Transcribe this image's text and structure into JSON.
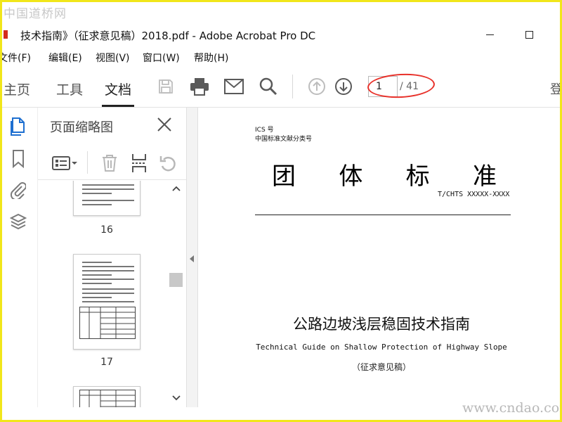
{
  "watermark": {
    "site_text": "中国道桥网",
    "url_text": "www.cndao.com"
  },
  "window": {
    "title": "技术指南》（征求意见稿）2018.pdf - Adobe Acrobat Pro DC",
    "controls": [
      "minimize-icon",
      "maximize-icon"
    ]
  },
  "menu": {
    "items": [
      "文件(F)",
      "编辑(E)",
      "视图(V)",
      "窗口(W)",
      "帮助(H)"
    ]
  },
  "nav": {
    "tabs": [
      {
        "label": "主页",
        "active": false
      },
      {
        "label": "工具",
        "active": false
      },
      {
        "label": "文档",
        "active": true
      }
    ],
    "tools": [
      "save-icon",
      "print-icon",
      "email-icon",
      "search-icon",
      "arrow-up-icon",
      "arrow-down-icon"
    ],
    "page_current": "1",
    "page_total": "/ 41",
    "right_label": "登"
  },
  "rail": {
    "icons": [
      "page-thumbnails-icon",
      "bookmark-icon",
      "attachment-icon",
      "layers-icon"
    ]
  },
  "thumbnails_panel": {
    "title": "页面缩略图",
    "tools": [
      "options-icon",
      "delete-icon",
      "insert-page-icon",
      "rotate-icon"
    ],
    "pages": [
      {
        "label": "16"
      },
      {
        "label": "17"
      }
    ]
  },
  "document": {
    "ics_label": "ICS 号",
    "classification_label": "中国标准文献分类号",
    "standard_type": [
      "团",
      "体",
      "标",
      "准"
    ],
    "standard_code": "T/CHTS XXXXX-XXXX",
    "main_title": "公路边坡浅层稳固技术指南",
    "english_title": "Technical Guide on Shallow Protection of Highway Slope",
    "draft_note": "（征求意见稿）"
  },
  "colors": {
    "highlight": "#e8312a",
    "frame": "#f1e61a",
    "pdf_red": "#d42b1e"
  }
}
